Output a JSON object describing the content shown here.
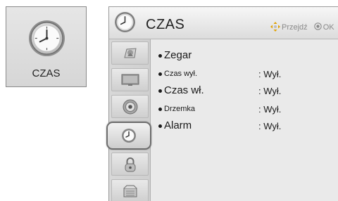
{
  "tile": {
    "icon": "clock-icon",
    "label": "CZAS"
  },
  "panel": {
    "title": "CZAS",
    "hint": {
      "move_icon": "four-way-arrow-icon",
      "move_label": "Przejdź",
      "ok_icon": "ok-button-icon",
      "ok_label": "OK"
    }
  },
  "sidebar": {
    "items": [
      {
        "icon": "picture-icon",
        "selected": false
      },
      {
        "icon": "tv-screen-icon",
        "selected": false
      },
      {
        "icon": "speaker-icon",
        "selected": false
      },
      {
        "icon": "clock-icon",
        "selected": true
      },
      {
        "icon": "lock-icon",
        "selected": false
      },
      {
        "icon": "settings-box-icon",
        "selected": false
      }
    ]
  },
  "menu": {
    "items": [
      {
        "label": "Zegar",
        "value": ""
      },
      {
        "label": "Czas wył.",
        "value": ": Wył."
      },
      {
        "label": "Czas wł.",
        "value": ": Wył."
      },
      {
        "label": "Drzemka",
        "value": ": Wył."
      },
      {
        "label": "Alarm",
        "value": ": Wył."
      }
    ]
  },
  "colors": {
    "panel_bg": "#eaeaea",
    "sidebar_bg": "#d3d3d3",
    "text": "#1a1a1a",
    "hint": "#8a8a8a",
    "selection_border": "#6d6d6d"
  }
}
